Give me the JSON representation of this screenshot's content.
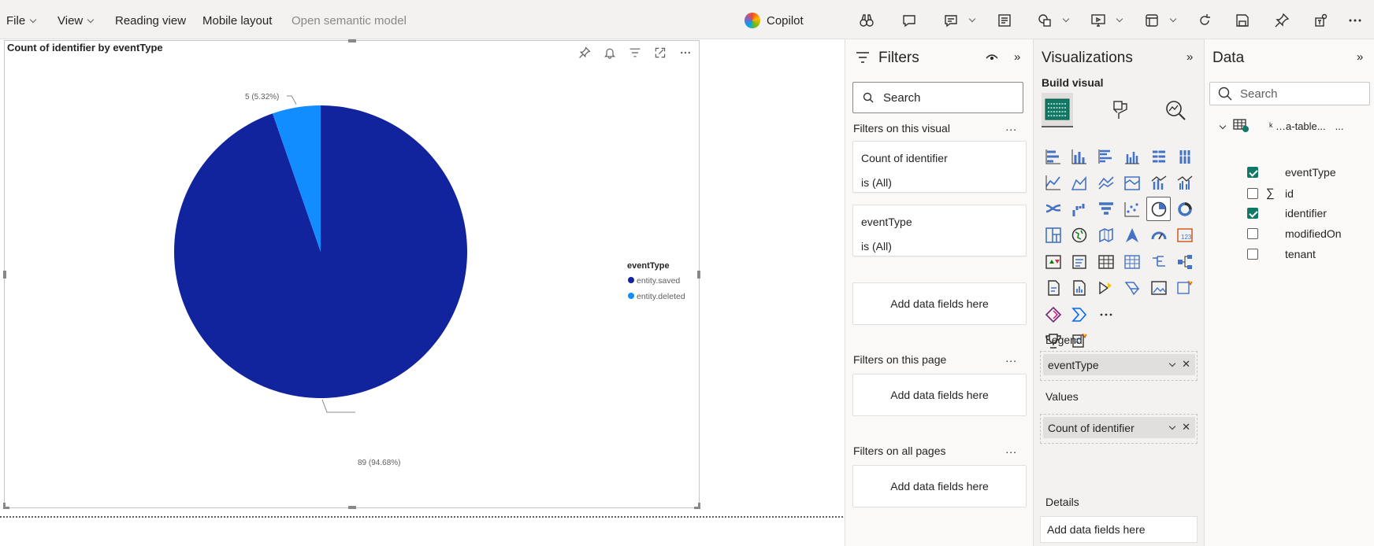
{
  "toolbar": {
    "menus": [
      {
        "label": "File",
        "has_dropdown": true
      },
      {
        "label": "View",
        "has_dropdown": true
      },
      {
        "label": "Reading view"
      },
      {
        "label": "Mobile layout"
      },
      {
        "label": "Open semantic model",
        "disabled": true
      }
    ],
    "copilot_label": "Copilot",
    "icons": [
      "binoculars-icon",
      "comment-icon",
      "smart-narrative-icon",
      "notes-icon",
      "shapes-icon",
      "present-icon",
      "view-icon",
      "refresh-icon",
      "save-icon",
      "pin-icon",
      "teams-icon",
      "more-icon"
    ]
  },
  "visual": {
    "title": "Count of identifier by eventType",
    "legend_title": "eventType",
    "label_small": "5 (5.32%)",
    "label_large": "89 (94.68%)"
  },
  "chart_data": {
    "type": "pie",
    "title": "Count of identifier by eventType",
    "legend_title": "eventType",
    "legend_position": "right",
    "slices": [
      {
        "name": "entity.saved",
        "value": 89,
        "percent": 94.68,
        "color": "#12239e",
        "label": "89 (94.68%)"
      },
      {
        "name": "entity.deleted",
        "value": 5,
        "percent": 5.32,
        "color": "#118dff",
        "label": "5 (5.32%)"
      }
    ]
  },
  "filters": {
    "title": "Filters",
    "search_placeholder": "Search",
    "on_visual": "Filters on this visual",
    "cards": [
      {
        "name": "Count of identifier",
        "state": "is (All)"
      },
      {
        "name": "eventType",
        "state": "is (All)"
      }
    ],
    "add_fields": "Add data fields here",
    "on_page": "Filters on this page",
    "on_all_pages": "Filters on all pages",
    "more": "..."
  },
  "visualizations": {
    "title": "Visualizations",
    "build_visual": "Build visual",
    "legend_label": "Legend",
    "legend_field": "eventType",
    "values_label": "Values",
    "values_field": "Count of identifier",
    "details_label": "Details",
    "details_placeholder": "Add data fields here",
    "more_visuals": "..."
  },
  "data_pane": {
    "title": "Data",
    "search_placeholder": "Search",
    "table_name": "ᵏ …a-table...",
    "table_more": "...",
    "fields": [
      {
        "name": "eventType",
        "checked": true,
        "sigma": false
      },
      {
        "name": "id",
        "checked": false,
        "sigma": true
      },
      {
        "name": "identifier",
        "checked": true,
        "sigma": false
      },
      {
        "name": "modifiedOn",
        "checked": false,
        "sigma": false
      },
      {
        "name": "tenant",
        "checked": false,
        "sigma": false
      }
    ]
  },
  "colors": {
    "saved": "#12239e",
    "deleted": "#118dff",
    "accent": "#117865"
  }
}
